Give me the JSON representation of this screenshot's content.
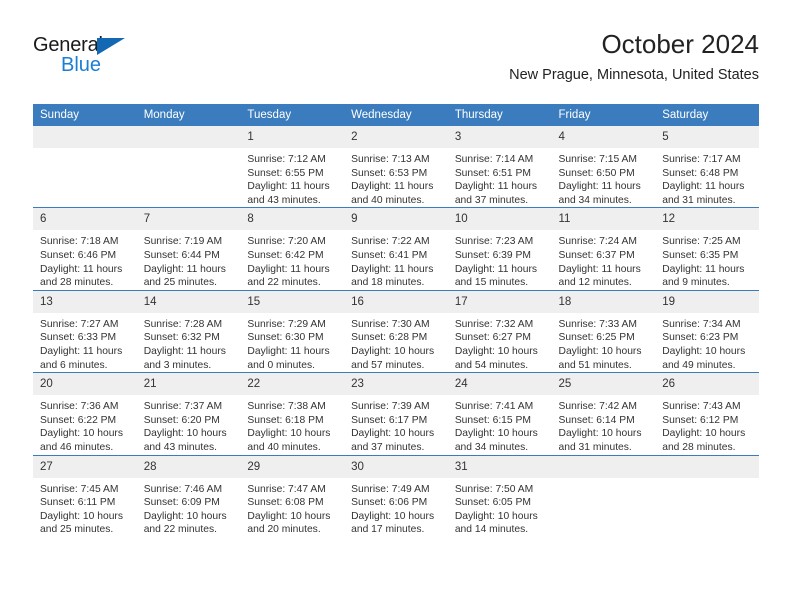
{
  "brand": {
    "name_part1": "General",
    "name_part2": "Blue",
    "triangle_icon": "triangle-icon",
    "accent_color": "#1268b3",
    "link_color": "#1a7fd4"
  },
  "header": {
    "title": "October 2024",
    "subtitle": "New Prague, Minnesota, United States"
  },
  "theme": {
    "header_blue": "#3a7cbd",
    "daynum_band": "#efefef",
    "text": "#333333"
  },
  "calendar": {
    "weekday_headers": [
      "Sunday",
      "Monday",
      "Tuesday",
      "Wednesday",
      "Thursday",
      "Friday",
      "Saturday"
    ],
    "weeks": [
      [
        {
          "day": "",
          "empty": true,
          "sunrise": "",
          "sunset": "",
          "daylight_line1": "",
          "daylight_line2": ""
        },
        {
          "day": "",
          "empty": true,
          "sunrise": "",
          "sunset": "",
          "daylight_line1": "",
          "daylight_line2": ""
        },
        {
          "day": "1",
          "empty": false,
          "sunrise": "Sunrise: 7:12 AM",
          "sunset": "Sunset: 6:55 PM",
          "daylight_line1": "Daylight: 11 hours",
          "daylight_line2": "and 43 minutes."
        },
        {
          "day": "2",
          "empty": false,
          "sunrise": "Sunrise: 7:13 AM",
          "sunset": "Sunset: 6:53 PM",
          "daylight_line1": "Daylight: 11 hours",
          "daylight_line2": "and 40 minutes."
        },
        {
          "day": "3",
          "empty": false,
          "sunrise": "Sunrise: 7:14 AM",
          "sunset": "Sunset: 6:51 PM",
          "daylight_line1": "Daylight: 11 hours",
          "daylight_line2": "and 37 minutes."
        },
        {
          "day": "4",
          "empty": false,
          "sunrise": "Sunrise: 7:15 AM",
          "sunset": "Sunset: 6:50 PM",
          "daylight_line1": "Daylight: 11 hours",
          "daylight_line2": "and 34 minutes."
        },
        {
          "day": "5",
          "empty": false,
          "sunrise": "Sunrise: 7:17 AM",
          "sunset": "Sunset: 6:48 PM",
          "daylight_line1": "Daylight: 11 hours",
          "daylight_line2": "and 31 minutes."
        }
      ],
      [
        {
          "day": "6",
          "empty": false,
          "sunrise": "Sunrise: 7:18 AM",
          "sunset": "Sunset: 6:46 PM",
          "daylight_line1": "Daylight: 11 hours",
          "daylight_line2": "and 28 minutes."
        },
        {
          "day": "7",
          "empty": false,
          "sunrise": "Sunrise: 7:19 AM",
          "sunset": "Sunset: 6:44 PM",
          "daylight_line1": "Daylight: 11 hours",
          "daylight_line2": "and 25 minutes."
        },
        {
          "day": "8",
          "empty": false,
          "sunrise": "Sunrise: 7:20 AM",
          "sunset": "Sunset: 6:42 PM",
          "daylight_line1": "Daylight: 11 hours",
          "daylight_line2": "and 22 minutes."
        },
        {
          "day": "9",
          "empty": false,
          "sunrise": "Sunrise: 7:22 AM",
          "sunset": "Sunset: 6:41 PM",
          "daylight_line1": "Daylight: 11 hours",
          "daylight_line2": "and 18 minutes."
        },
        {
          "day": "10",
          "empty": false,
          "sunrise": "Sunrise: 7:23 AM",
          "sunset": "Sunset: 6:39 PM",
          "daylight_line1": "Daylight: 11 hours",
          "daylight_line2": "and 15 minutes."
        },
        {
          "day": "11",
          "empty": false,
          "sunrise": "Sunrise: 7:24 AM",
          "sunset": "Sunset: 6:37 PM",
          "daylight_line1": "Daylight: 11 hours",
          "daylight_line2": "and 12 minutes."
        },
        {
          "day": "12",
          "empty": false,
          "sunrise": "Sunrise: 7:25 AM",
          "sunset": "Sunset: 6:35 PM",
          "daylight_line1": "Daylight: 11 hours",
          "daylight_line2": "and 9 minutes."
        }
      ],
      [
        {
          "day": "13",
          "empty": false,
          "sunrise": "Sunrise: 7:27 AM",
          "sunset": "Sunset: 6:33 PM",
          "daylight_line1": "Daylight: 11 hours",
          "daylight_line2": "and 6 minutes."
        },
        {
          "day": "14",
          "empty": false,
          "sunrise": "Sunrise: 7:28 AM",
          "sunset": "Sunset: 6:32 PM",
          "daylight_line1": "Daylight: 11 hours",
          "daylight_line2": "and 3 minutes."
        },
        {
          "day": "15",
          "empty": false,
          "sunrise": "Sunrise: 7:29 AM",
          "sunset": "Sunset: 6:30 PM",
          "daylight_line1": "Daylight: 11 hours",
          "daylight_line2": "and 0 minutes."
        },
        {
          "day": "16",
          "empty": false,
          "sunrise": "Sunrise: 7:30 AM",
          "sunset": "Sunset: 6:28 PM",
          "daylight_line1": "Daylight: 10 hours",
          "daylight_line2": "and 57 minutes."
        },
        {
          "day": "17",
          "empty": false,
          "sunrise": "Sunrise: 7:32 AM",
          "sunset": "Sunset: 6:27 PM",
          "daylight_line1": "Daylight: 10 hours",
          "daylight_line2": "and 54 minutes."
        },
        {
          "day": "18",
          "empty": false,
          "sunrise": "Sunrise: 7:33 AM",
          "sunset": "Sunset: 6:25 PM",
          "daylight_line1": "Daylight: 10 hours",
          "daylight_line2": "and 51 minutes."
        },
        {
          "day": "19",
          "empty": false,
          "sunrise": "Sunrise: 7:34 AM",
          "sunset": "Sunset: 6:23 PM",
          "daylight_line1": "Daylight: 10 hours",
          "daylight_line2": "and 49 minutes."
        }
      ],
      [
        {
          "day": "20",
          "empty": false,
          "sunrise": "Sunrise: 7:36 AM",
          "sunset": "Sunset: 6:22 PM",
          "daylight_line1": "Daylight: 10 hours",
          "daylight_line2": "and 46 minutes."
        },
        {
          "day": "21",
          "empty": false,
          "sunrise": "Sunrise: 7:37 AM",
          "sunset": "Sunset: 6:20 PM",
          "daylight_line1": "Daylight: 10 hours",
          "daylight_line2": "and 43 minutes."
        },
        {
          "day": "22",
          "empty": false,
          "sunrise": "Sunrise: 7:38 AM",
          "sunset": "Sunset: 6:18 PM",
          "daylight_line1": "Daylight: 10 hours",
          "daylight_line2": "and 40 minutes."
        },
        {
          "day": "23",
          "empty": false,
          "sunrise": "Sunrise: 7:39 AM",
          "sunset": "Sunset: 6:17 PM",
          "daylight_line1": "Daylight: 10 hours",
          "daylight_line2": "and 37 minutes."
        },
        {
          "day": "24",
          "empty": false,
          "sunrise": "Sunrise: 7:41 AM",
          "sunset": "Sunset: 6:15 PM",
          "daylight_line1": "Daylight: 10 hours",
          "daylight_line2": "and 34 minutes."
        },
        {
          "day": "25",
          "empty": false,
          "sunrise": "Sunrise: 7:42 AM",
          "sunset": "Sunset: 6:14 PM",
          "daylight_line1": "Daylight: 10 hours",
          "daylight_line2": "and 31 minutes."
        },
        {
          "day": "26",
          "empty": false,
          "sunrise": "Sunrise: 7:43 AM",
          "sunset": "Sunset: 6:12 PM",
          "daylight_line1": "Daylight: 10 hours",
          "daylight_line2": "and 28 minutes."
        }
      ],
      [
        {
          "day": "27",
          "empty": false,
          "sunrise": "Sunrise: 7:45 AM",
          "sunset": "Sunset: 6:11 PM",
          "daylight_line1": "Daylight: 10 hours",
          "daylight_line2": "and 25 minutes."
        },
        {
          "day": "28",
          "empty": false,
          "sunrise": "Sunrise: 7:46 AM",
          "sunset": "Sunset: 6:09 PM",
          "daylight_line1": "Daylight: 10 hours",
          "daylight_line2": "and 22 minutes."
        },
        {
          "day": "29",
          "empty": false,
          "sunrise": "Sunrise: 7:47 AM",
          "sunset": "Sunset: 6:08 PM",
          "daylight_line1": "Daylight: 10 hours",
          "daylight_line2": "and 20 minutes."
        },
        {
          "day": "30",
          "empty": false,
          "sunrise": "Sunrise: 7:49 AM",
          "sunset": "Sunset: 6:06 PM",
          "daylight_line1": "Daylight: 10 hours",
          "daylight_line2": "and 17 minutes."
        },
        {
          "day": "31",
          "empty": false,
          "sunrise": "Sunrise: 7:50 AM",
          "sunset": "Sunset: 6:05 PM",
          "daylight_line1": "Daylight: 10 hours",
          "daylight_line2": "and 14 minutes."
        },
        {
          "day": "",
          "empty": true,
          "sunrise": "",
          "sunset": "",
          "daylight_line1": "",
          "daylight_line2": ""
        },
        {
          "day": "",
          "empty": true,
          "sunrise": "",
          "sunset": "",
          "daylight_line1": "",
          "daylight_line2": ""
        }
      ]
    ]
  }
}
